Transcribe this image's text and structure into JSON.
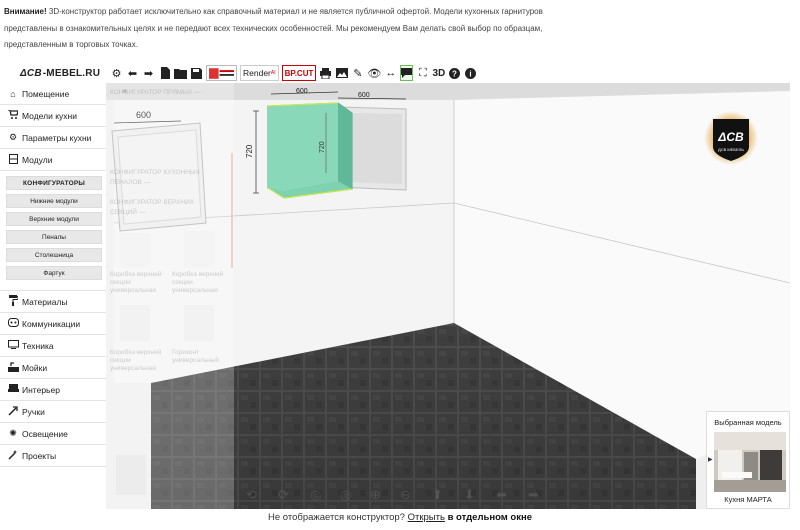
{
  "notice": {
    "bold": "Внимание!",
    "line1": " 3D-конструктор работает исключительно как справочный материал и не является публичной офертой. Модели кухонных гарнитуров",
    "line2": "представлены в ознакомительных целях и не передают всех технических особенностей. Мы рекомендуем Вам делать свой выбор по образцам,",
    "line3": "представленным в торговых точках."
  },
  "logo": {
    "mark": "ΔCB",
    "text": "-MEBEL.RU"
  },
  "toolbar": {
    "tools": [
      {
        "name": "settings-icon",
        "glyph": "⚙"
      },
      {
        "name": "undo-icon",
        "glyph": "←"
      },
      {
        "name": "redo-icon",
        "glyph": "→"
      },
      {
        "name": "new-file-icon",
        "glyph": "▮"
      },
      {
        "name": "open-folder-icon",
        "glyph": "▬"
      },
      {
        "name": "save-icon",
        "glyph": "▦"
      }
    ],
    "render_label": "Render",
    "render_sup": "AI",
    "bpcut_label": "BP.CUT",
    "t3d_label": "3D"
  },
  "sidebar": {
    "items_top": [
      {
        "label": "Помещение",
        "icon": "home-icon",
        "glyph": "⌂"
      },
      {
        "label": "Модели кухни",
        "icon": "cart-icon",
        "glyph": "🛒"
      },
      {
        "label": "Параметры кухни",
        "icon": "gear-icon",
        "glyph": "⚙"
      },
      {
        "label": "Модули",
        "icon": "cabinet-icon",
        "glyph": "▤"
      }
    ],
    "sub_items": [
      "КОНФИГУРАТОРЫ",
      "Нижние модули",
      "Верхние модули",
      "Пеналы",
      "Столешница",
      "Фартук"
    ],
    "items_bottom": [
      {
        "label": "Материалы",
        "icon": "paint-roller-icon",
        "glyph": "▬"
      },
      {
        "label": "Коммуникации",
        "icon": "socket-icon",
        "glyph": "◉"
      },
      {
        "label": "Техника",
        "icon": "tv-icon",
        "glyph": "▭"
      },
      {
        "label": "Мойки",
        "icon": "sink-icon",
        "glyph": "▙"
      },
      {
        "label": "Интерьер",
        "icon": "sofa-icon",
        "glyph": "▀"
      },
      {
        "label": "Ручки",
        "icon": "handle-icon",
        "glyph": "↗"
      },
      {
        "label": "Освещение",
        "icon": "lightbulb-icon",
        "glyph": "✺"
      },
      {
        "label": "Проекты",
        "icon": "magic-wand-icon",
        "glyph": "✦"
      }
    ]
  },
  "scene": {
    "dim_width_left": "600",
    "dim_height": "720",
    "dim_top_a": "600",
    "dim_top_b": "600",
    "dim_inner": "720"
  },
  "panel": {
    "lines": [
      "КОНФИГУРАТОР ПРЯМЫХ —",
      "КОНФИГУРАТОР КУХОННЫХ",
      "ПЕНАЛОВ —",
      "КОНФИГУРАТОР ВЕРХНИХ",
      "СЕКЦИЙ —"
    ],
    "card1": "Коробка верхней секции универсальная",
    "card2": "Коробка верхней секции универсальная",
    "card3": "Коробка верхней секции универсальная",
    "card4": "Горизонт универсальный"
  },
  "chosen": {
    "title": "Выбранная модель",
    "name": "Кухня МАРТА"
  },
  "brand": {
    "text": "ДСВ МЕБЕЛЬ"
  },
  "bottom": {
    "prefix": "Не отображается конструктор?",
    "link": "Открыть",
    "suffix": "в отдельном окне"
  },
  "colors": {
    "module_green": "#7fd1b0",
    "floor_tile": "#4a4a4a",
    "accent_gold": "#d8a441"
  }
}
